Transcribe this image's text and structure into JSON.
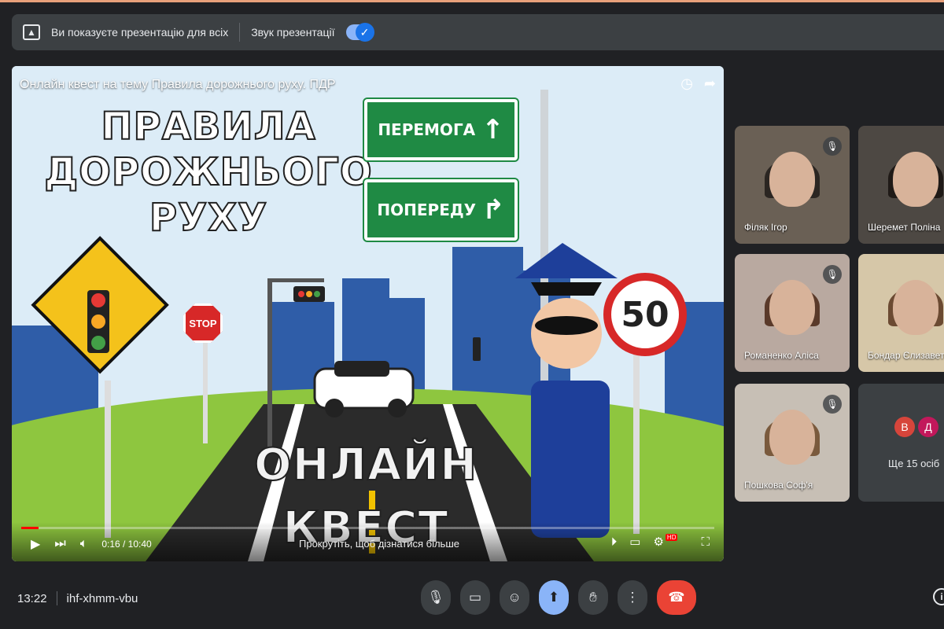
{
  "present_bar": {
    "presenting_text": "Ви показуєте презентацію для всіх",
    "sound_label": "Звук презентації",
    "sound_enabled": true
  },
  "video": {
    "title": "Онлайн квест на тему Правила дорожнього руху. ПДР",
    "headline": "ПРАВИЛА ДОРОЖНЬОГО РУХУ",
    "sign_victory": "ПЕРЕМОГА",
    "sign_ahead": "ПОПЕРЕДУ",
    "stop_text": "STOP",
    "speed_limit": "50",
    "bottom_title": "ОНЛАЙН КВЕСТ",
    "time": "0:16 / 10:40",
    "scroll_hint": "Прокрутіть, щоб дізнатися більше",
    "progress_fraction": 0.025
  },
  "participants": [
    {
      "name": "Філяк Ігор",
      "muted": true
    },
    {
      "name": "Шеремет Поліна",
      "muted": false
    },
    {
      "name": "Романенко Аліса",
      "muted": true
    },
    {
      "name": "Бондар Єлизавета",
      "muted": false
    },
    {
      "name": "Пошкова Соф'я",
      "muted": true
    }
  ],
  "more": {
    "avatars": [
      {
        "letter": "В",
        "color": "#d6453b"
      },
      {
        "letter": "Д",
        "color": "#c2185b"
      }
    ],
    "text": "Ще 15 осіб"
  },
  "meeting": {
    "time": "13:22",
    "code": "ihf-xhmm-vbu"
  }
}
